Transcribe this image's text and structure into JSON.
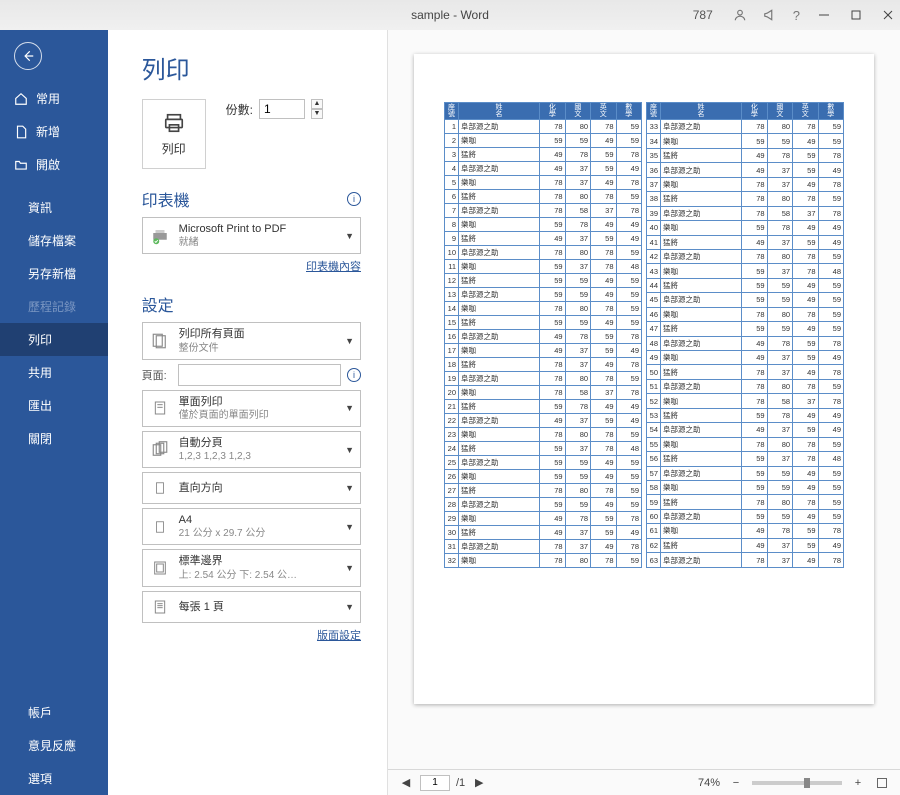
{
  "titlebar": {
    "title": "sample - Word",
    "number": "787"
  },
  "nav": {
    "back_aria": "返回",
    "home": "常用",
    "new": "新增",
    "open": "開啟",
    "info": "資訊",
    "save": "儲存檔案",
    "saveas": "另存新檔",
    "history": "歷程記錄",
    "print": "列印",
    "share": "共用",
    "export": "匯出",
    "close": "關閉",
    "account": "帳戶",
    "feedback": "意見反應",
    "options": "選項"
  },
  "panel": {
    "title": "列印",
    "print_btn": "列印",
    "copies_label": "份數:",
    "copies_value": "1",
    "printer_title": "印表機",
    "printer_name": "Microsoft Print to PDF",
    "printer_status": "就緒",
    "printer_props": "印表機內容",
    "settings_title": "設定",
    "pages_all": "列印所有頁面",
    "pages_all_sub": "整份文件",
    "pages_label": "頁面:",
    "sides": "單面列印",
    "sides_sub": "僅於頁面的單面列印",
    "collate": "自動分頁",
    "collate_sub": "1,2,3   1,2,3   1,2,3",
    "orientation": "直向方向",
    "paper": "A4",
    "paper_sub": "21 公分 x 29.7 公分",
    "margins": "標準邊界",
    "margins_sub": "上: 2.54 公分 下: 2.54 公…",
    "sheets": "每張 1 頁",
    "page_setup": "版面設定"
  },
  "preview": {
    "page_input": "1",
    "page_total": "/1",
    "zoom": "74%",
    "headers": [
      "座號",
      "姓名",
      "化學",
      "國文",
      "英文",
      "數學"
    ],
    "names": [
      "阜部源之助",
      "樂咖",
      "猛將"
    ],
    "scores": [
      [
        78,
        80,
        78,
        59
      ],
      [
        59,
        59,
        49,
        59
      ],
      [
        49,
        78,
        59,
        78
      ],
      [
        49,
        37,
        59,
        49
      ],
      [
        78,
        37,
        49,
        78
      ],
      [
        78,
        80,
        78,
        59
      ],
      [
        78,
        58,
        37,
        78
      ],
      [
        59,
        78,
        49,
        49
      ],
      [
        49,
        37,
        59,
        49
      ],
      [
        78,
        80,
        78,
        59
      ],
      [
        59,
        37,
        78,
        48
      ],
      [
        59,
        59,
        49,
        59
      ],
      [
        59,
        59,
        49,
        59
      ]
    ],
    "left_count": 32,
    "right_count": 31
  }
}
